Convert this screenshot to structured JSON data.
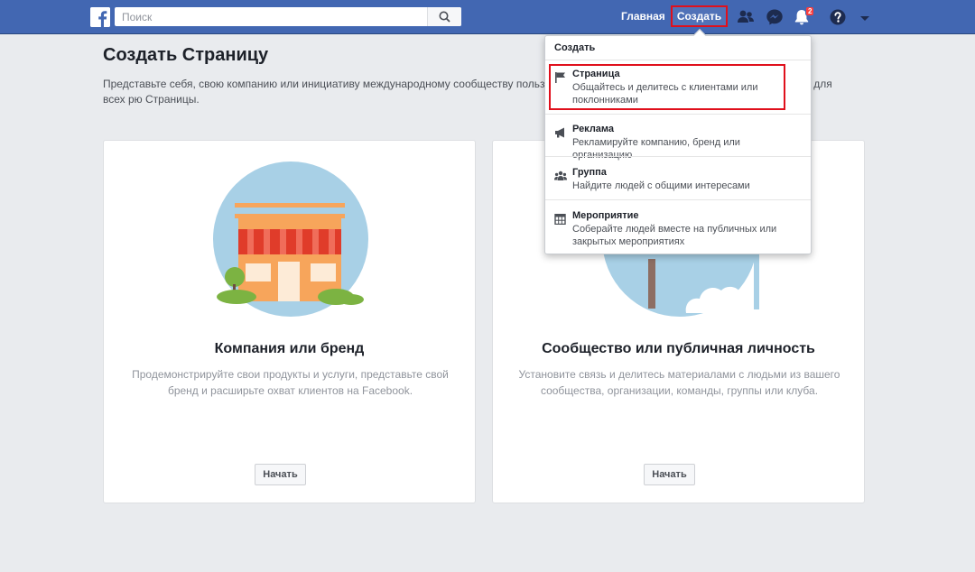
{
  "topbar": {
    "search_placeholder": "Поиск",
    "home_label": "Главная",
    "create_label": "Создать",
    "notifications_count": "2"
  },
  "page": {
    "title": "Создать Страницу",
    "description": "Представьте себя, свою компанию или инициативу международному сообществу пользователей Facebook, создав бесплатную и доступную для всех рю Страницы."
  },
  "cards": [
    {
      "title": "Компания или бренд",
      "description": "Продемонстрируйте свои продукты и услуги, представьте свой бренд и расширьте охват клиентов на Facebook.",
      "button": "Начать"
    },
    {
      "title": "Сообщество или публичная личность",
      "description": "Установите связь и делитесь материалами с людьми из вашего сообщества, организации, команды, группы или клуба.",
      "button": "Начать"
    }
  ],
  "dropdown": {
    "header": "Создать",
    "items": [
      {
        "title": "Страница",
        "subtitle": "Общайтесь и делитесь с клиентами или поклонниками",
        "icon": "flag-icon"
      },
      {
        "title": "Реклама",
        "subtitle": "Рекламируйте компанию, бренд или организацию",
        "icon": "megaphone-icon"
      },
      {
        "title": "Группа",
        "subtitle": "Найдите людей с общими интересами",
        "icon": "group-icon"
      },
      {
        "title": "Мероприятие",
        "subtitle": "Соберайте людей вместе на публичных или закрытых мероприятиях",
        "icon": "calendar-icon"
      }
    ]
  },
  "colors": {
    "brand_blue": "#4267b2",
    "highlight_red": "#e0101c",
    "background": "#e9ebee"
  }
}
